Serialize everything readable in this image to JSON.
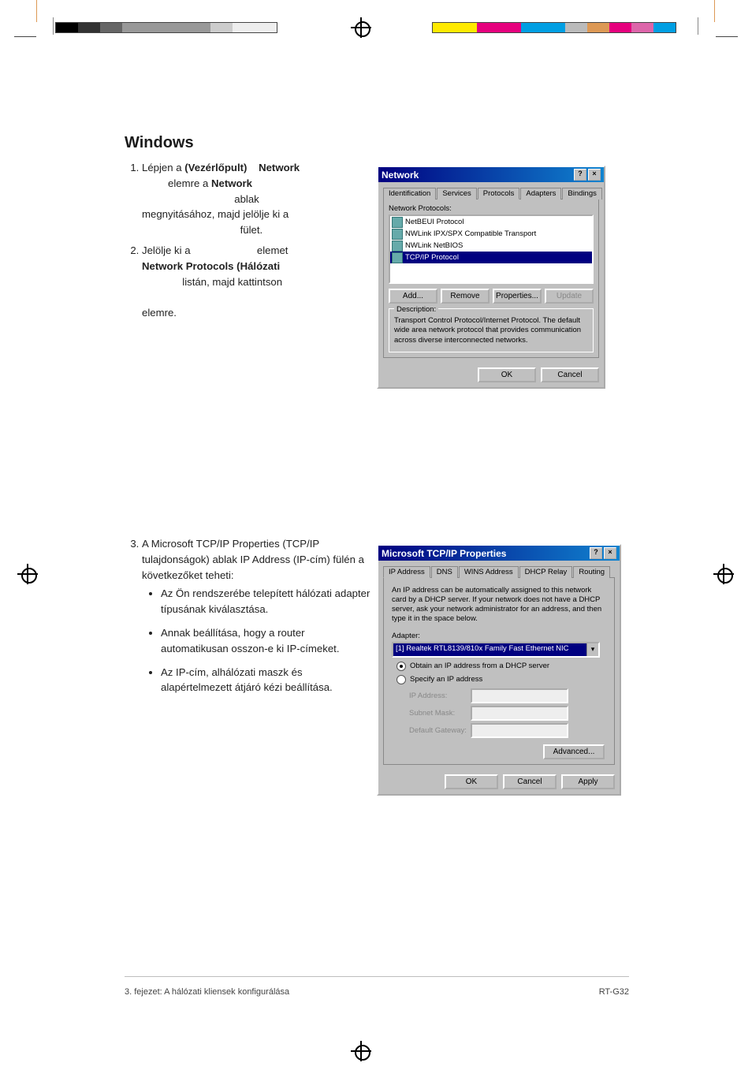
{
  "heading": "Windows",
  "steps": {
    "s1_a": "Lépjen a",
    "s1_b": "(Vezérlőpult)",
    "s1_c": "Network",
    "s1_d": "elemre a",
    "s1_e": "Network",
    "s1_f": "ablak megnyitásához, majd jelölje ki a",
    "s1_g": "fület.",
    "s2_a": "Jelölje ki a",
    "s2_b": "elemet",
    "s2_c": "Network Protocols (Hálózati",
    "s2_d": "listán, majd kattintson",
    "s2_e": "elemre."
  },
  "step3": {
    "lead": "A Microsoft TCP/IP Properties (TCP/IP tulajdonságok) ablak IP Address (IP-cím) fülén a következőket teheti:",
    "b1": "Az Ön rendszerébe telepített hálózati adapter típusának kiválasztása.",
    "b2": "Annak beállítása, hogy a router automatikusan osszon-e ki IP-címeket.",
    "b3": "Az IP-cím, alhálózati maszk és alapértelmezett átjáró kézi beállítása."
  },
  "dlg1": {
    "title": "Network",
    "tabs": [
      "Identification",
      "Services",
      "Protocols",
      "Adapters",
      "Bindings"
    ],
    "activeTab": 2,
    "listLabel": "Network Protocols:",
    "items": [
      "NetBEUI Protocol",
      "NWLink IPX/SPX Compatible Transport",
      "NWLink NetBIOS",
      "TCP/IP Protocol"
    ],
    "selectedIndex": 3,
    "buttons": {
      "add": "Add...",
      "remove": "Remove",
      "properties": "Properties...",
      "update": "Update"
    },
    "descLegend": "Description:",
    "descText": "Transport Control Protocol/Internet Protocol. The default wide area network protocol that provides communication across diverse interconnected networks.",
    "ok": "OK",
    "cancel": "Cancel"
  },
  "dlg2": {
    "title": "Microsoft TCP/IP Properties",
    "tabs": [
      "IP Address",
      "DNS",
      "WINS Address",
      "DHCP Relay",
      "Routing"
    ],
    "activeTab": 0,
    "info": "An IP address can be automatically assigned to this network card by a DHCP server. If your network does not have a DHCP server, ask your network administrator for an address, and then type it in the space below.",
    "adapterLabel": "Adapter:",
    "adapterValue": "[1] Realtek RTL8139/810x Family Fast Ethernet NIC",
    "radioObtain": "Obtain an IP address from a DHCP server",
    "radioSpecify": "Specify an IP address",
    "ipLabel": "IP Address:",
    "subnetLabel": "Subnet Mask:",
    "gatewayLabel": "Default Gateway:",
    "advanced": "Advanced...",
    "ok": "OK",
    "cancel": "Cancel",
    "apply": "Apply"
  },
  "footer": {
    "left": "3. fejezet: A hálózati kliensek konfigurálása",
    "right": "RT-G32"
  }
}
